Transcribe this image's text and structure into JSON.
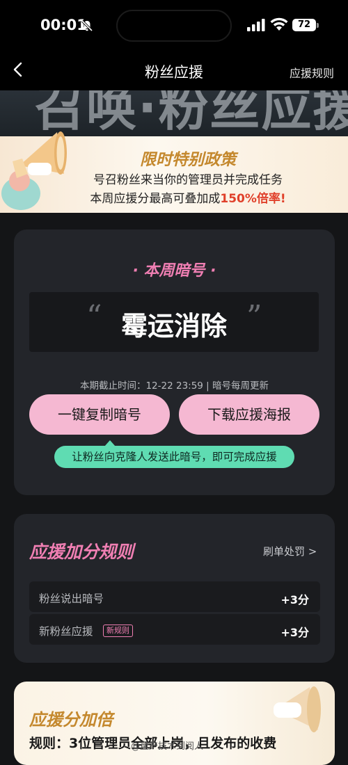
{
  "status_bar": {
    "time": "00:01",
    "battery": "72"
  },
  "nav": {
    "title": "粉丝应援",
    "rules_link": "应援规则"
  },
  "banner": {
    "text": "召唤·粉丝应援"
  },
  "policy": {
    "title": "限时特别政策",
    "line1": "号召粉丝来当你的管理员并完成任务",
    "line2_prefix": "本周应援分最高可叠加成",
    "line2_highlight": "150%倍率!"
  },
  "code_card": {
    "title": "· 本周暗号 ·",
    "code": "霉运消除",
    "deadline": "本期截止时间：12-22 23:59 | 暗号每周更新",
    "copy_button": "一键复制暗号",
    "poster_button": "下载应援海报",
    "tip": "让粉丝向克隆人发送此暗号，即可完成应援"
  },
  "rules_card": {
    "title": "应援加分规则",
    "penalty_link": "刷单处罚 >",
    "rows": [
      {
        "label": "粉丝说出暗号",
        "value": "+3分"
      },
      {
        "label": "新粉丝应援",
        "badge": "新规则",
        "value": "+3分"
      }
    ]
  },
  "bonus_card": {
    "title": "应援分加倍",
    "text": "规则：3位管理员全部上岗，且发布的收费"
  },
  "watermark": "@量产技术到阅人"
}
